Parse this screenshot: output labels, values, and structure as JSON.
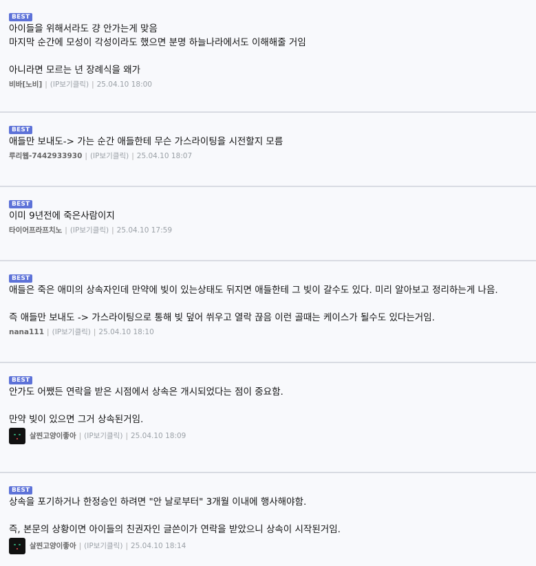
{
  "comments": [
    {
      "badge": "BEST",
      "text": "아이들을 위해서라도 걍 안가는게 맞음\n마지막 순간에 모성이 각성이라도 했으면 분명 하늘나라에서도 이해해줄 거임\n\n아니라면 모르는 년 장례식을 왜가",
      "author": "비바[노비]",
      "ip": "(IP보기클릭)",
      "date": "25.04.10 18:00",
      "has_avatar": false
    },
    {
      "badge": "BEST",
      "text": "애들만 보내도-> 가는 순간 애들한테 무슨 가스라이팅을 시전할지 모름",
      "author": "루리웹-7442933930",
      "ip": "(IP보기클릭)",
      "date": "25.04.10 18:07",
      "has_avatar": false
    },
    {
      "badge": "BEST",
      "text": "이미 9년전에 죽은사람이지",
      "author": "타이어프라프치노",
      "ip": "(IP보기클릭)",
      "date": "25.04.10 17:59",
      "has_avatar": false
    },
    {
      "badge": "BEST",
      "text": "애들은 죽은 애미의 상속자인데 만약에 빚이 있는상태도 뒤지면 애들한테 그 빚이 갈수도 있다. 미리 알아보고 정리하는게 나음.\n\n즉 애들만 보내도 -> 가스라이팅으로 통해 빚 덮어 쒸우고 열락 끊음 이런 골때는 케이스가 될수도 있다는거임.",
      "author": "nana111",
      "ip": "(IP보기클릭)",
      "date": "25.04.10 18:10",
      "has_avatar": false
    },
    {
      "badge": "BEST",
      "text": "안가도 어쨌든 연락을 받은 시점에서 상속은 개시되었다는 점이 중요함.\n\n만약 빚이 있으면 그거 상속된거임.",
      "author": "살찐고양이좋아",
      "ip": "(IP보기클릭)",
      "date": "25.04.10 18:09",
      "has_avatar": true
    },
    {
      "badge": "BEST",
      "text": "상속을 포기하거나 한정승인 하려면 \"안 날로부터\" 3개월 이내에 행사해야함.\n\n즉, 본문의 상황이면 아이들의 친권자인 글쓴이가 연락을 받았으니 상속이 시작된거임.",
      "author": "살찐고양이좋아",
      "ip": "(IP보기클릭)",
      "date": "25.04.10 18:14",
      "has_avatar": true
    }
  ]
}
